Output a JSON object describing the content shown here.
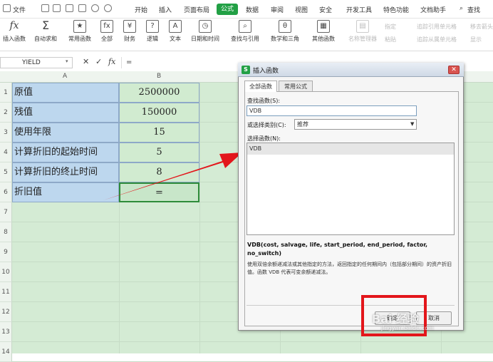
{
  "menubar": {
    "file": "文件",
    "tabs": [
      "开始",
      "插入",
      "页面布局",
      "公式",
      "数据",
      "审阅",
      "视图",
      "安全",
      "开发工具",
      "特色功能",
      "文档助手"
    ],
    "active_tab": "公式",
    "search": "查找"
  },
  "ribbon": {
    "insert_function": "插入函数",
    "autosum": "自动求和",
    "common": "常用函数",
    "all": "全部",
    "finance": "财务",
    "logic": "逻辑",
    "text": "文本",
    "datetime": "日期和时间",
    "lookup": "查找与引用",
    "math": "数学和三角",
    "other": "其他函数",
    "name_manager": "名称管理器",
    "specify": "指定",
    "paste": "粘贴",
    "trace_precedents": "追踪引用单元格",
    "trace_dependents": "追踪从属单元格",
    "remove_arrows": "移去箭头",
    "show": "显示"
  },
  "formula_bar": {
    "name_box": "YIELD",
    "cancel": "✕",
    "confirm": "✓",
    "fx": "fx",
    "value": "="
  },
  "grid": {
    "columns": [
      "A",
      "B"
    ],
    "rows": [
      "1",
      "2",
      "3",
      "4",
      "5",
      "6",
      "7",
      "8",
      "9",
      "10",
      "11",
      "12",
      "13",
      "14"
    ],
    "data": [
      {
        "label": "原值",
        "value": "2500000"
      },
      {
        "label": "残值",
        "value": "150000"
      },
      {
        "label": "使用年限",
        "value": "15"
      },
      {
        "label": "计算折旧的起始时间",
        "value": "5"
      },
      {
        "label": "计算折旧的终止时间",
        "value": "8"
      },
      {
        "label": "折旧值",
        "value": "="
      }
    ]
  },
  "dialog": {
    "logo": "S",
    "title": "插入函数",
    "close": "✕",
    "tabs": [
      "全部函数",
      "常用公式"
    ],
    "search_label": "查找函数(S):",
    "search_value": "VDB",
    "category_label": "或选择类别(C):",
    "category_value": "推荐",
    "list_label": "选择函数(N):",
    "functions": [
      "VDB"
    ],
    "signature": "VDB(cost, salvage, life, start_period, end_period, factor, no_switch)",
    "description": "使用双倍余额递减法或其他指定的方法，返回指定的任何期间内（包括部分期间）的资产折旧值。函数 VDB 代表可变余额递减法。",
    "ok": "确定",
    "cancel": "取消"
  },
  "watermark": {
    "brand": "Bai 经验",
    "url": "jingyan.baidu.com"
  },
  "colors": {
    "accent": "#22a045",
    "label_cells": "#bdd7ee",
    "grid_bg": "#d4ebd4",
    "arrow": "#e3161b"
  }
}
